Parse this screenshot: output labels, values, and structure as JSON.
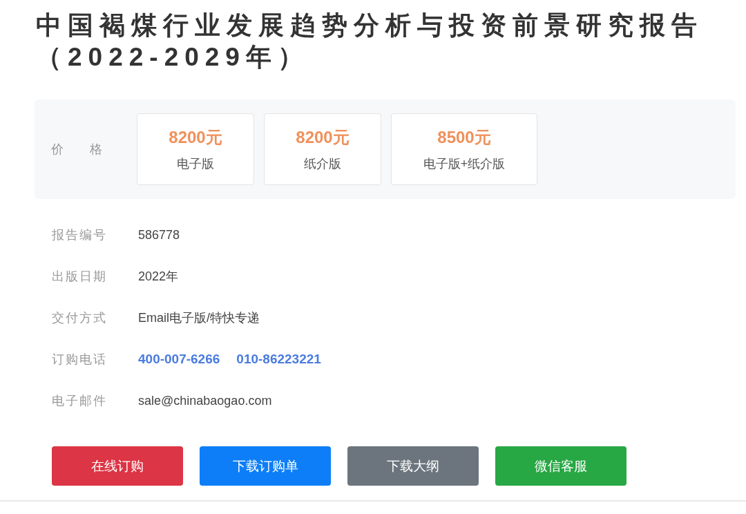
{
  "title": "中国褐煤行业发展趋势分析与投资前景研究报告（2022-2029年）",
  "price": {
    "label": "价格",
    "options": [
      {
        "price": "8200元",
        "edition": "电子版"
      },
      {
        "price": "8200元",
        "edition": "纸介版"
      },
      {
        "price": "8500元",
        "edition": "电子版+纸介版"
      }
    ]
  },
  "details": [
    {
      "label": "报告编号",
      "kind": "text",
      "values": [
        "586778"
      ]
    },
    {
      "label": "出版日期",
      "kind": "text",
      "values": [
        "2022年"
      ]
    },
    {
      "label": "交付方式",
      "kind": "text",
      "values": [
        "Email电子版/特快专递"
      ]
    },
    {
      "label": "订购电话",
      "kind": "phone",
      "values": [
        "400-007-6266",
        "010-86223221"
      ]
    },
    {
      "label": "电子邮件",
      "kind": "text",
      "values": [
        "sale@chinabaogao.com"
      ]
    }
  ],
  "buttons": [
    {
      "label": "在线订购",
      "kind": "danger"
    },
    {
      "label": "下载订购单",
      "kind": "primary"
    },
    {
      "label": "下载大纲",
      "kind": "secondary"
    },
    {
      "label": "微信客服",
      "kind": "success"
    }
  ]
}
